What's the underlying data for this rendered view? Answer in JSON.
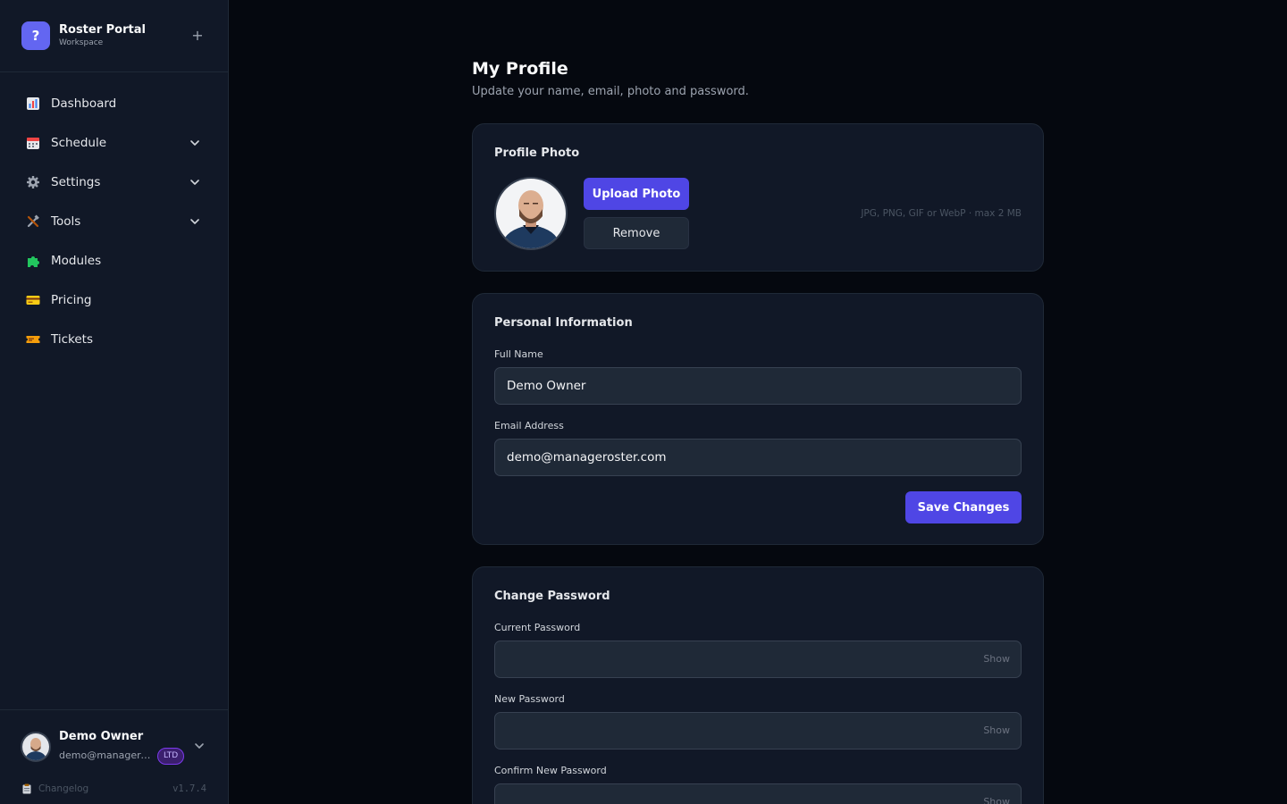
{
  "brand": {
    "logo": "?",
    "title": "Roster Portal",
    "subtitle": "Workspace",
    "add_icon": "+"
  },
  "nav": {
    "items": [
      {
        "label": "Dashboard",
        "icon": "bar-chart-icon"
      },
      {
        "label": "Schedule",
        "icon": "calendar-icon",
        "expandable": true
      },
      {
        "label": "Settings",
        "icon": "gear-icon",
        "expandable": true
      },
      {
        "label": "Tools",
        "icon": "tools-icon",
        "expandable": true
      },
      {
        "label": "Modules",
        "icon": "puzzle-icon"
      },
      {
        "label": "Pricing",
        "icon": "credit-card-icon"
      },
      {
        "label": "Tickets",
        "icon": "ticket-icon"
      }
    ]
  },
  "user": {
    "name": "Demo Owner",
    "email": "demo@manageroster.com",
    "badge": "LTD",
    "changelog": "Changelog",
    "version": "v1.7.4"
  },
  "page": {
    "title": "My Profile",
    "subtitle": "Update your name, email, photo and password."
  },
  "photo": {
    "title": "Profile Photo",
    "upload_label": "Upload Photo",
    "remove_label": "Remove",
    "hint": "JPG, PNG, GIF or WebP · max 2 MB"
  },
  "personal": {
    "title": "Personal Information",
    "name_label": "Full Name",
    "name_value": "Demo Owner",
    "email_label": "Email Address",
    "email_value": "demo@manageroster.com",
    "save_label": "Save Changes"
  },
  "password": {
    "title": "Change Password",
    "current_label": "Current Password",
    "new_label": "New Password",
    "confirm_label": "Confirm New Password",
    "show_label": "Show"
  },
  "colors": {
    "background": "#05080f",
    "sidebar": "#111827",
    "card": "#111827",
    "accent": "#4f46e5",
    "brand": "#6366f1"
  }
}
